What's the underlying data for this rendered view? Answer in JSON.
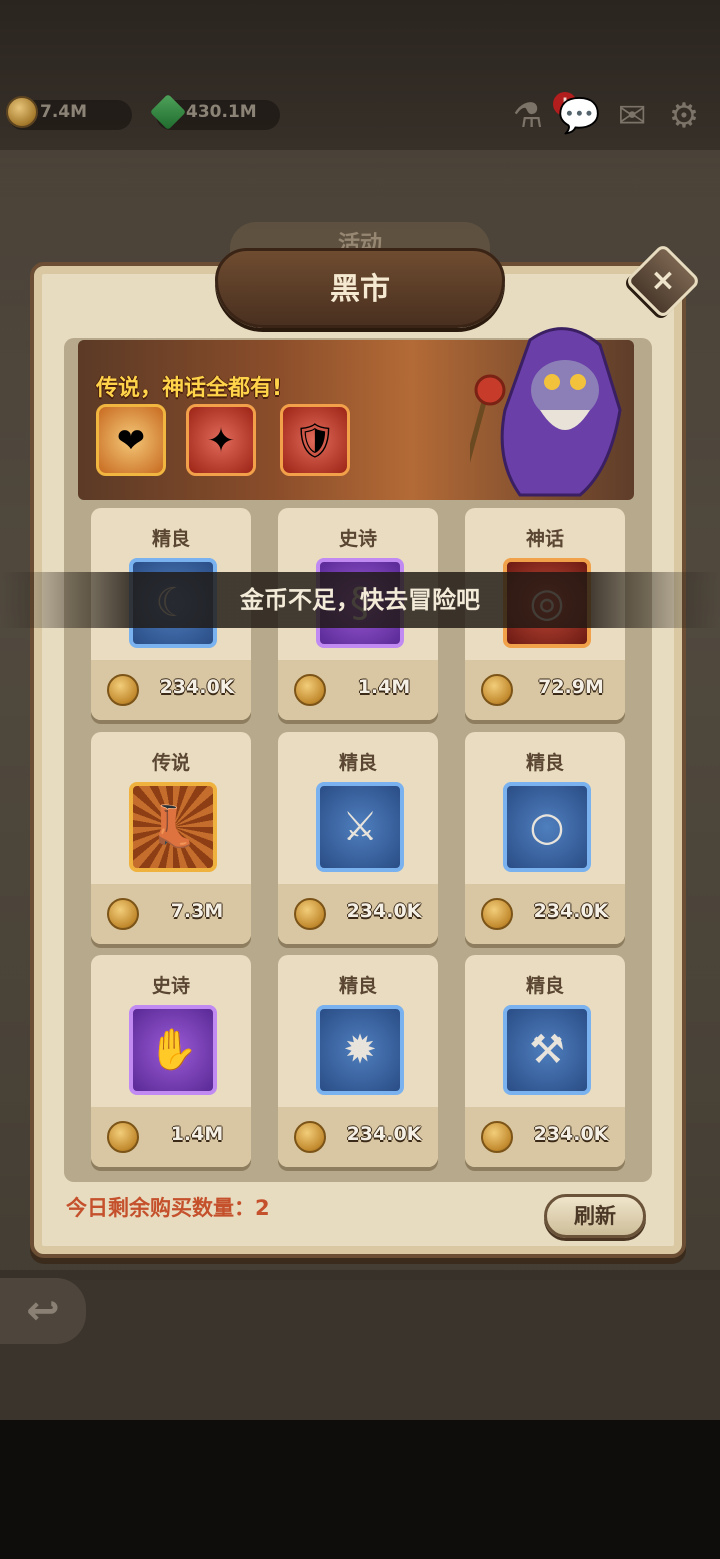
{
  "resources": {
    "coins": "7.4M",
    "gems": "430.1M"
  },
  "background_tab": "活动",
  "modal": {
    "title": "黑市",
    "close_symbol": "×"
  },
  "banner": {
    "slogan": "传说，神话全都有!",
    "featured_items": [
      "heart-scepter-icon",
      "winged-wand-icon",
      "armor-icon"
    ]
  },
  "items": [
    {
      "rarity": "精良",
      "price": "234.0K",
      "icon": "scythe-icon"
    },
    {
      "rarity": "史诗",
      "price": "1.4M",
      "icon": "tentacle-icon"
    },
    {
      "rarity": "神话",
      "price": "72.9M",
      "icon": "ring-icon"
    },
    {
      "rarity": "传说",
      "price": "7.3M",
      "icon": "boot-icon"
    },
    {
      "rarity": "精良",
      "price": "234.0K",
      "icon": "scimitar-icon"
    },
    {
      "rarity": "精良",
      "price": "234.0K",
      "icon": "bracelet-icon"
    },
    {
      "rarity": "史诗",
      "price": "1.4M",
      "icon": "gauntlet-icon"
    },
    {
      "rarity": "精良",
      "price": "234.0K",
      "icon": "spiked-helmet-icon"
    },
    {
      "rarity": "精良",
      "price": "234.0K",
      "icon": "axe-shield-icon"
    }
  ],
  "toast": "金币不足，快去冒险吧",
  "remaining_purchases": "今日剩余购买数量：2",
  "refresh_label": "刷新",
  "back_symbol": "↩"
}
